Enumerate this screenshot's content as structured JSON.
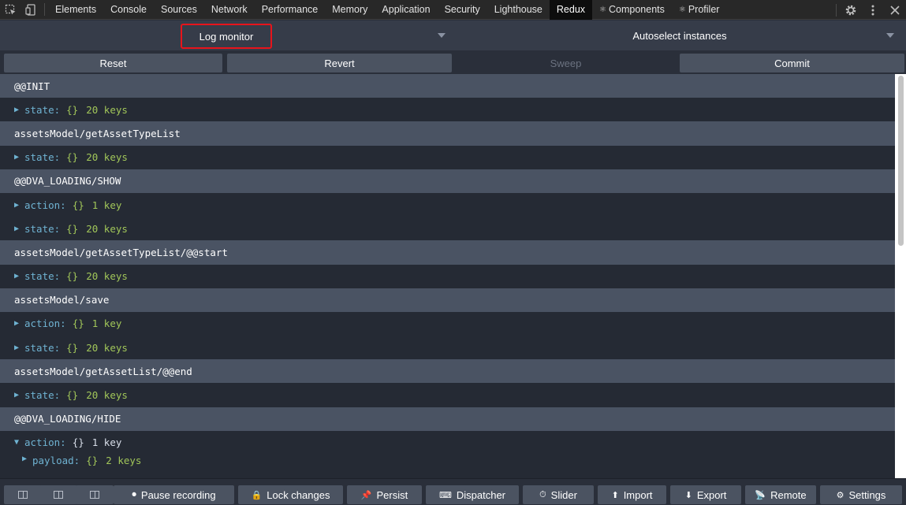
{
  "devtools": {
    "tabs": [
      {
        "label": "Elements",
        "glyph": ""
      },
      {
        "label": "Console",
        "glyph": ""
      },
      {
        "label": "Sources",
        "glyph": ""
      },
      {
        "label": "Network",
        "glyph": ""
      },
      {
        "label": "Performance",
        "glyph": ""
      },
      {
        "label": "Memory",
        "glyph": ""
      },
      {
        "label": "Application",
        "glyph": ""
      },
      {
        "label": "Security",
        "glyph": ""
      },
      {
        "label": "Lighthouse",
        "glyph": ""
      },
      {
        "label": "Redux",
        "glyph": ""
      },
      {
        "label": "Components",
        "glyph": "⚛"
      },
      {
        "label": "Profiler",
        "glyph": "⚛"
      }
    ],
    "active_tab": "Redux"
  },
  "selectors": {
    "monitor": "Log monitor",
    "instances": "Autoselect instances"
  },
  "actions_bar": {
    "reset": "Reset",
    "revert": "Revert",
    "sweep": "Sweep",
    "commit": "Commit"
  },
  "log": [
    {
      "kind": "action",
      "text": "@@INIT"
    },
    {
      "kind": "tree",
      "key": "state:",
      "brace": "{}",
      "count": "20 keys",
      "open": false
    },
    {
      "kind": "action",
      "text": "assetsModel/getAssetTypeList"
    },
    {
      "kind": "tree",
      "key": "state:",
      "brace": "{}",
      "count": "20 keys",
      "open": false
    },
    {
      "kind": "action",
      "text": "@@DVA_LOADING/SHOW"
    },
    {
      "kind": "tree",
      "key": "action:",
      "brace": "{}",
      "count": "1 key",
      "open": false
    },
    {
      "kind": "tree",
      "key": "state:",
      "brace": "{}",
      "count": "20 keys",
      "open": false
    },
    {
      "kind": "action",
      "text": "assetsModel/getAssetTypeList/@@start"
    },
    {
      "kind": "tree",
      "key": "state:",
      "brace": "{}",
      "count": "20 keys",
      "open": false
    },
    {
      "kind": "action",
      "text": "assetsModel/save"
    },
    {
      "kind": "tree",
      "key": "action:",
      "brace": "{}",
      "count": "1 key",
      "open": false
    },
    {
      "kind": "tree",
      "key": "state:",
      "brace": "{}",
      "count": "20 keys",
      "open": false
    },
    {
      "kind": "action",
      "text": "assetsModel/getAssetList/@@end"
    },
    {
      "kind": "tree",
      "key": "state:",
      "brace": "{}",
      "count": "20 keys",
      "open": false
    },
    {
      "kind": "action",
      "text": "@@DVA_LOADING/HIDE"
    },
    {
      "kind": "tree",
      "key": "action:",
      "brace": "{}",
      "count": "1 key",
      "open": true
    },
    {
      "kind": "nested",
      "key": "payload:",
      "brace": "{}",
      "count": "2 keys",
      "open": false
    }
  ],
  "bottom_bar": {
    "pause": "Pause recording",
    "lock": "Lock changes",
    "persist": "Persist",
    "dispatcher": "Dispatcher",
    "slider": "Slider",
    "import": "Import",
    "export": "Export",
    "remote": "Remote",
    "settings": "Settings"
  },
  "icons": {
    "pause": "⏺",
    "lock": "🔒",
    "persist": "📌",
    "dispatcher": "⌨",
    "slider": "⏱",
    "import": "⬆",
    "export": "⬇",
    "remote": "📡",
    "settings": "⚙"
  }
}
